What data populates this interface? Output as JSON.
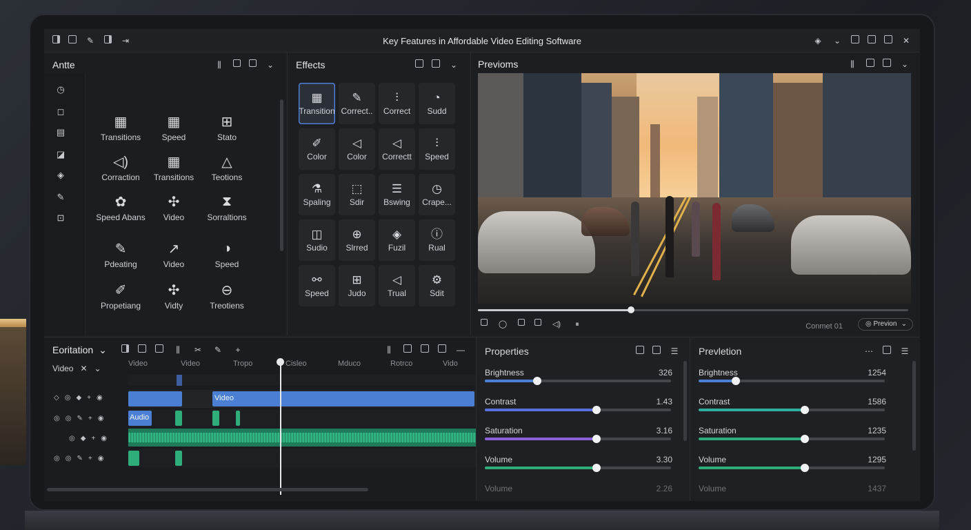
{
  "app": {
    "title": "Key Features in Affordable Video Editing Software"
  },
  "assets": {
    "title": "Antte",
    "items": [
      {
        "label": "Transitions",
        "icon": "film-icon"
      },
      {
        "label": "Speed",
        "icon": "film-icon"
      },
      {
        "label": "Stato",
        "icon": "grid-icon"
      },
      {
        "label": "Corraction",
        "icon": "speaker-icon"
      },
      {
        "label": "Transitions",
        "icon": "film-icon"
      },
      {
        "label": "Teotions",
        "icon": "shape-icon"
      },
      {
        "label": "Speed Abans",
        "icon": "sparkle-icon"
      },
      {
        "label": "Video",
        "icon": "puzzle-icon"
      },
      {
        "label": "Sorraltions",
        "icon": "hourglass-icon"
      },
      {
        "label": "Pdeating",
        "icon": "edit-icon"
      },
      {
        "label": "Video",
        "icon": "chart-icon"
      },
      {
        "label": "Speed",
        "icon": "pie-icon"
      },
      {
        "label": "Propetiang",
        "icon": "pen-icon"
      },
      {
        "label": "Vidty",
        "icon": "puzzle-icon"
      },
      {
        "label": "Treotiens",
        "icon": "minus-circle-icon"
      }
    ]
  },
  "effects": {
    "title": "Effects",
    "tiles": [
      {
        "label": "Transition",
        "glyph": "▦"
      },
      {
        "label": "Correct..",
        "glyph": "✎"
      },
      {
        "label": "Correct",
        "glyph": "⫶"
      },
      {
        "label": "Sudd",
        "glyph": "◔"
      },
      {
        "label": "Color",
        "glyph": "✐"
      },
      {
        "label": "Color",
        "glyph": "◁"
      },
      {
        "label": "Correctt",
        "glyph": "◁"
      },
      {
        "label": "Speed",
        "glyph": "⫶"
      },
      {
        "label": "Spaling",
        "glyph": "⚗"
      },
      {
        "label": "Sdir",
        "glyph": "⬚"
      },
      {
        "label": "Bswing",
        "glyph": "☰"
      },
      {
        "label": "Crape...",
        "glyph": "◷"
      },
      {
        "label": "Sudio",
        "glyph": "◫"
      },
      {
        "label": "Slrred",
        "glyph": "⊕"
      },
      {
        "label": "Fuzil",
        "glyph": "◈"
      },
      {
        "label": "Rual",
        "glyph": "ⓘ"
      },
      {
        "label": "Speed",
        "glyph": "⚯"
      },
      {
        "label": "Judo",
        "glyph": "⊞"
      },
      {
        "label": "Trual",
        "glyph": "◁"
      },
      {
        "label": "Sdit",
        "glyph": "⚙"
      }
    ]
  },
  "preview": {
    "title": "Previoms",
    "progress": 0.355,
    "frame_label": "Conmet 01",
    "mode_label": "Previon"
  },
  "timeline": {
    "title": "Eoritation",
    "track_label": "Video",
    "ruler": [
      "Video",
      "Video",
      "Tropo",
      "Cisleo",
      "Mduco",
      "Rotrco",
      "Vido"
    ],
    "clips": {
      "video_label": "Video",
      "audio_label": "Audio"
    }
  },
  "properties": {
    "title": "Properties",
    "items": [
      {
        "name": "Brightness",
        "value": "326",
        "fraction": 0.28,
        "color": "#4a7fd4"
      },
      {
        "name": "Contrast",
        "value": "1.43",
        "fraction": 0.6,
        "color": "#5a6fe0"
      },
      {
        "name": "Saturation",
        "value": "3.16",
        "fraction": 0.6,
        "color": "#8b5fd8"
      },
      {
        "name": "Volume",
        "value": "3.30",
        "fraction": 0.6,
        "color": "#2fae7c"
      },
      {
        "name": "Volume",
        "value": "2.26"
      }
    ]
  },
  "prevention": {
    "title": "Prevletion",
    "items": [
      {
        "name": "Brightness",
        "value": "1254",
        "fraction": 0.2,
        "color": "#4a7fd4"
      },
      {
        "name": "Contrast",
        "value": "1586",
        "fraction": 0.57,
        "color": "#2fae9e"
      },
      {
        "name": "Saturation",
        "value": "1235",
        "fraction": 0.57,
        "color": "#2fae7c"
      },
      {
        "name": "Volume",
        "value": "1295",
        "fraction": 0.57,
        "color": "#2fae7c"
      },
      {
        "name": "Volume",
        "value": "1437"
      }
    ]
  }
}
